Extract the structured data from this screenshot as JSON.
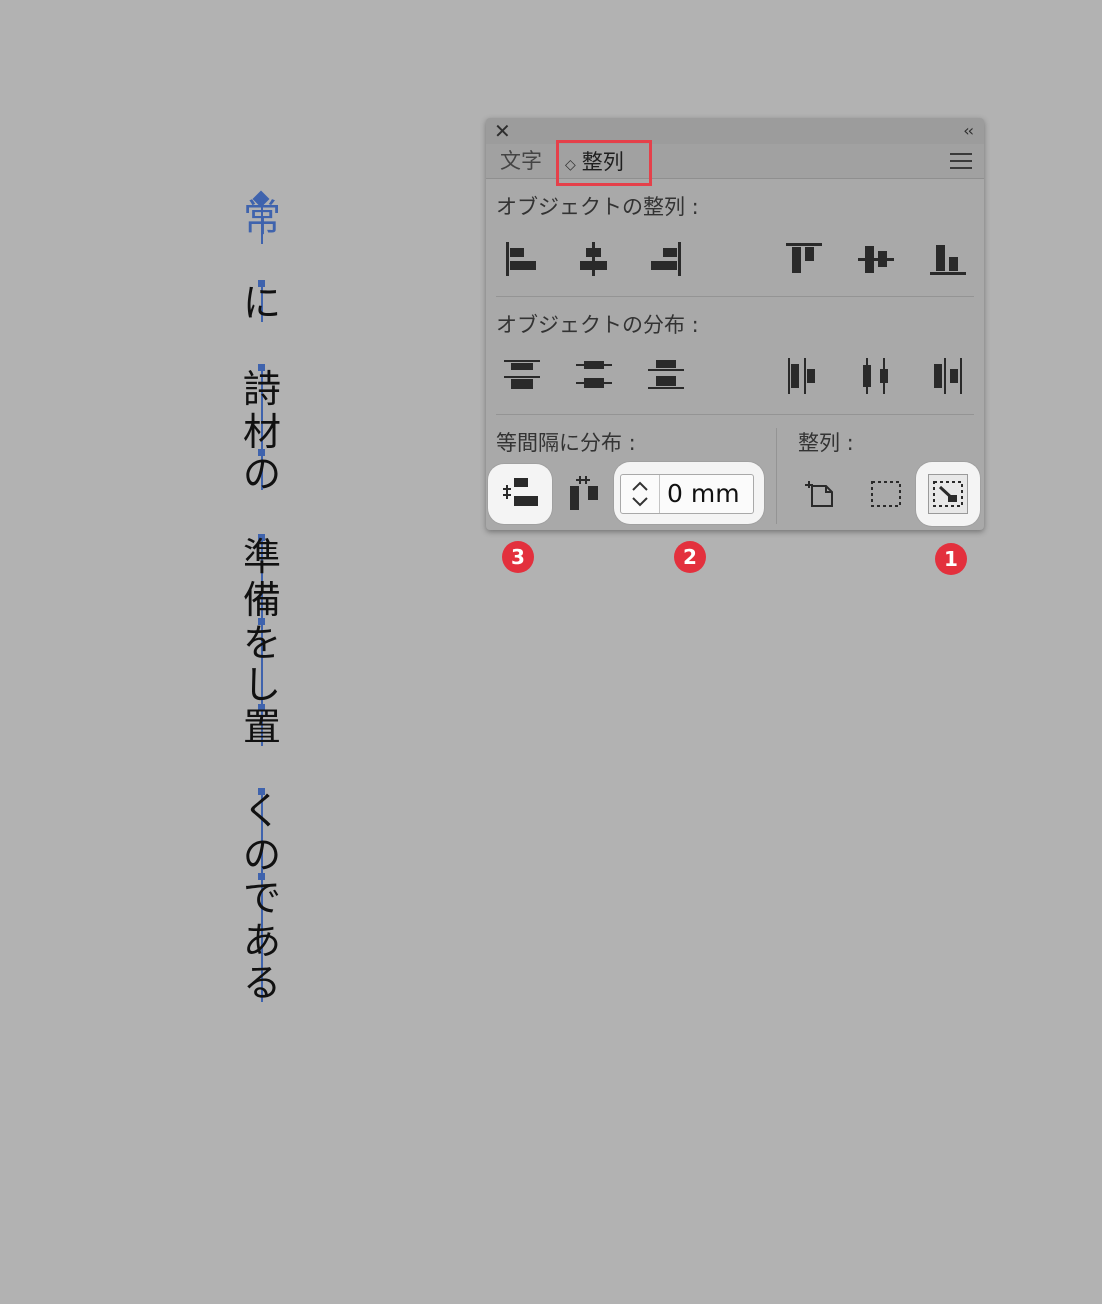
{
  "artboard": {
    "vertical_text": {
      "selected_char": "常",
      "chars": [
        "に",
        "詩",
        "材",
        "の",
        "準",
        "備",
        "を",
        "し",
        "置",
        "く",
        "の",
        "で",
        "あ",
        "る"
      ]
    }
  },
  "panel": {
    "tabs": [
      {
        "label": "文字"
      },
      {
        "label": "整列"
      }
    ],
    "align_objects": {
      "label": "オブジェクトの整列 :",
      "icons": [
        "align-left-icon",
        "align-horizontal-center-icon",
        "align-right-icon",
        "align-top-icon",
        "align-vertical-center-icon",
        "align-bottom-icon"
      ]
    },
    "distribute_objects": {
      "label": "オブジェクトの分布 :",
      "icons": [
        "distribute-top-icon",
        "distribute-vertical-center-icon",
        "distribute-bottom-icon",
        "distribute-left-icon",
        "distribute-horizontal-center-icon",
        "distribute-right-icon"
      ]
    },
    "distribute_spacing": {
      "label": "等間隔に分布 :",
      "spacing_value": "0 mm",
      "icons": [
        "vertical-distribute-space-icon",
        "horizontal-distribute-space-icon"
      ]
    },
    "align_to": {
      "label": "整列 :",
      "icons": [
        "align-to-artboard-icon",
        "align-to-selection-icon",
        "align-to-key-object-icon"
      ]
    }
  },
  "annotations": {
    "badge_1": "1",
    "badge_2": "2",
    "badge_3": "3",
    "highlight_color": "#e5404a",
    "badge_color": "#e3303d"
  }
}
